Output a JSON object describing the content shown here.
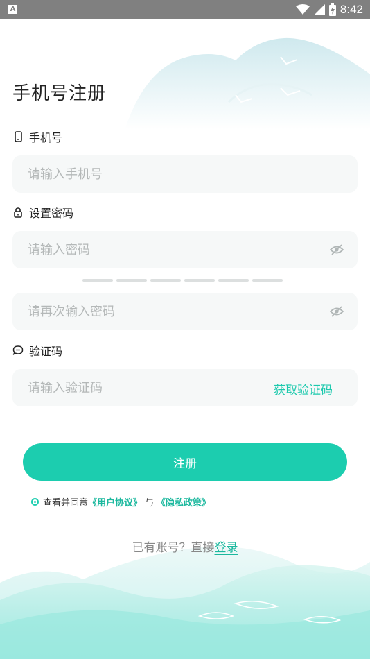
{
  "status_bar": {
    "time": "8:42",
    "icons": [
      "notification-a-icon",
      "wifi-icon",
      "cell-signal-icon",
      "battery-charging-icon"
    ]
  },
  "page": {
    "title": "手机号注册"
  },
  "phone": {
    "label": "手机号",
    "icon": "phone-icon",
    "placeholder": "请输入手机号",
    "value": ""
  },
  "password": {
    "label": "设置密码",
    "icon": "lock-icon",
    "placeholder": "请输入密码",
    "value": "",
    "strength_segments": 6,
    "strength_level": 0
  },
  "password_confirm": {
    "placeholder": "请再次输入密码",
    "value": ""
  },
  "code": {
    "label": "验证码",
    "icon": "chat-bubble-icon",
    "placeholder": "请输入验证码",
    "value": "",
    "get_code_label": "获取验证码"
  },
  "register": {
    "button_label": "注册"
  },
  "agreement": {
    "prefix": "查看并同意",
    "user_agreement": "《用户协议》",
    "and": "与",
    "privacy_policy": "《隐私政策》"
  },
  "login": {
    "prompt": "已有账号？直接",
    "link": "登录"
  },
  "colors": {
    "accent": "#1ccdaf",
    "link": "#1bb89e",
    "status_bar": "#808080",
    "input_bg": "#f6f8f8"
  }
}
